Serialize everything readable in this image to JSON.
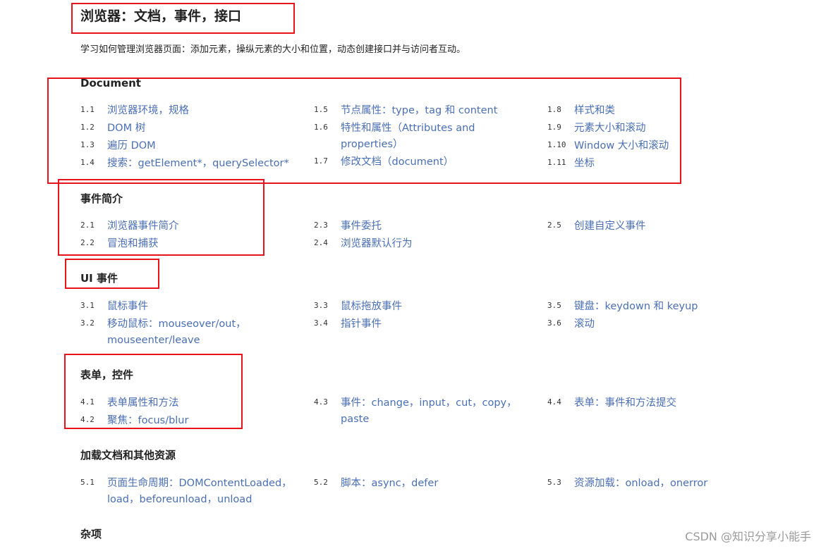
{
  "page": {
    "title": "浏览器：文档，事件，接口",
    "intro": "学习如何管理浏览器页面：添加元素，操纵元素的大小和位置，动态创建接口并与访问者互动。"
  },
  "sections": [
    {
      "title": "Document",
      "items": [
        {
          "num": "1.1",
          "label": "浏览器环境，规格"
        },
        {
          "num": "1.2",
          "label": "DOM 树"
        },
        {
          "num": "1.3",
          "label": "遍历 DOM"
        },
        {
          "num": "1.4",
          "label": "搜索：getElement*，querySelector*"
        },
        {
          "num": "1.5",
          "label": "节点属性：type，tag 和 content"
        },
        {
          "num": "1.6",
          "label": "特性和属性（Attributes and properties）"
        },
        {
          "num": "1.7",
          "label": "修改文档（document）"
        },
        {
          "num": "1.8",
          "label": "样式和类"
        },
        {
          "num": "1.9",
          "label": "元素大小和滚动"
        },
        {
          "num": "1.10",
          "label": "Window 大小和滚动"
        },
        {
          "num": "1.11",
          "label": "坐标"
        }
      ]
    },
    {
      "title": "事件简介",
      "items": [
        {
          "num": "2.1",
          "label": "浏览器事件简介"
        },
        {
          "num": "2.2",
          "label": "冒泡和捕获"
        },
        {
          "num": "2.3",
          "label": "事件委托"
        },
        {
          "num": "2.4",
          "label": "浏览器默认行为"
        },
        {
          "num": "2.5",
          "label": "创建自定义事件"
        }
      ]
    },
    {
      "title": "UI 事件",
      "items": [
        {
          "num": "3.1",
          "label": "鼠标事件"
        },
        {
          "num": "3.2",
          "label": "移动鼠标：mouseover/out，mouseenter/leave"
        },
        {
          "num": "3.3",
          "label": "鼠标拖放事件"
        },
        {
          "num": "3.4",
          "label": "指针事件"
        },
        {
          "num": "3.5",
          "label": "键盘：keydown 和 keyup"
        },
        {
          "num": "3.6",
          "label": "滚动"
        }
      ]
    },
    {
      "title": "表单，控件",
      "items": [
        {
          "num": "4.1",
          "label": "表单属性和方法"
        },
        {
          "num": "4.2",
          "label": "聚焦：focus/blur"
        },
        {
          "num": "4.3",
          "label": "事件：change，input，cut，copy，paste"
        },
        {
          "num": "4.4",
          "label": "表单：事件和方法提交"
        }
      ]
    },
    {
      "title": "加载文档和其他资源",
      "items": [
        {
          "num": "5.1",
          "label": "页面生命周期：DOMContentLoaded，load，beforeunload，unload"
        },
        {
          "num": "5.2",
          "label": "脚本：async，defer"
        },
        {
          "num": "5.3",
          "label": "资源加载：onload，onerror"
        }
      ]
    },
    {
      "title": "杂项",
      "items": []
    }
  ],
  "watermark": "CSDN @知识分享小能手",
  "colors": {
    "link": "#4a6fb5",
    "annotation_box": "#e8141c",
    "heading": "#222222"
  }
}
